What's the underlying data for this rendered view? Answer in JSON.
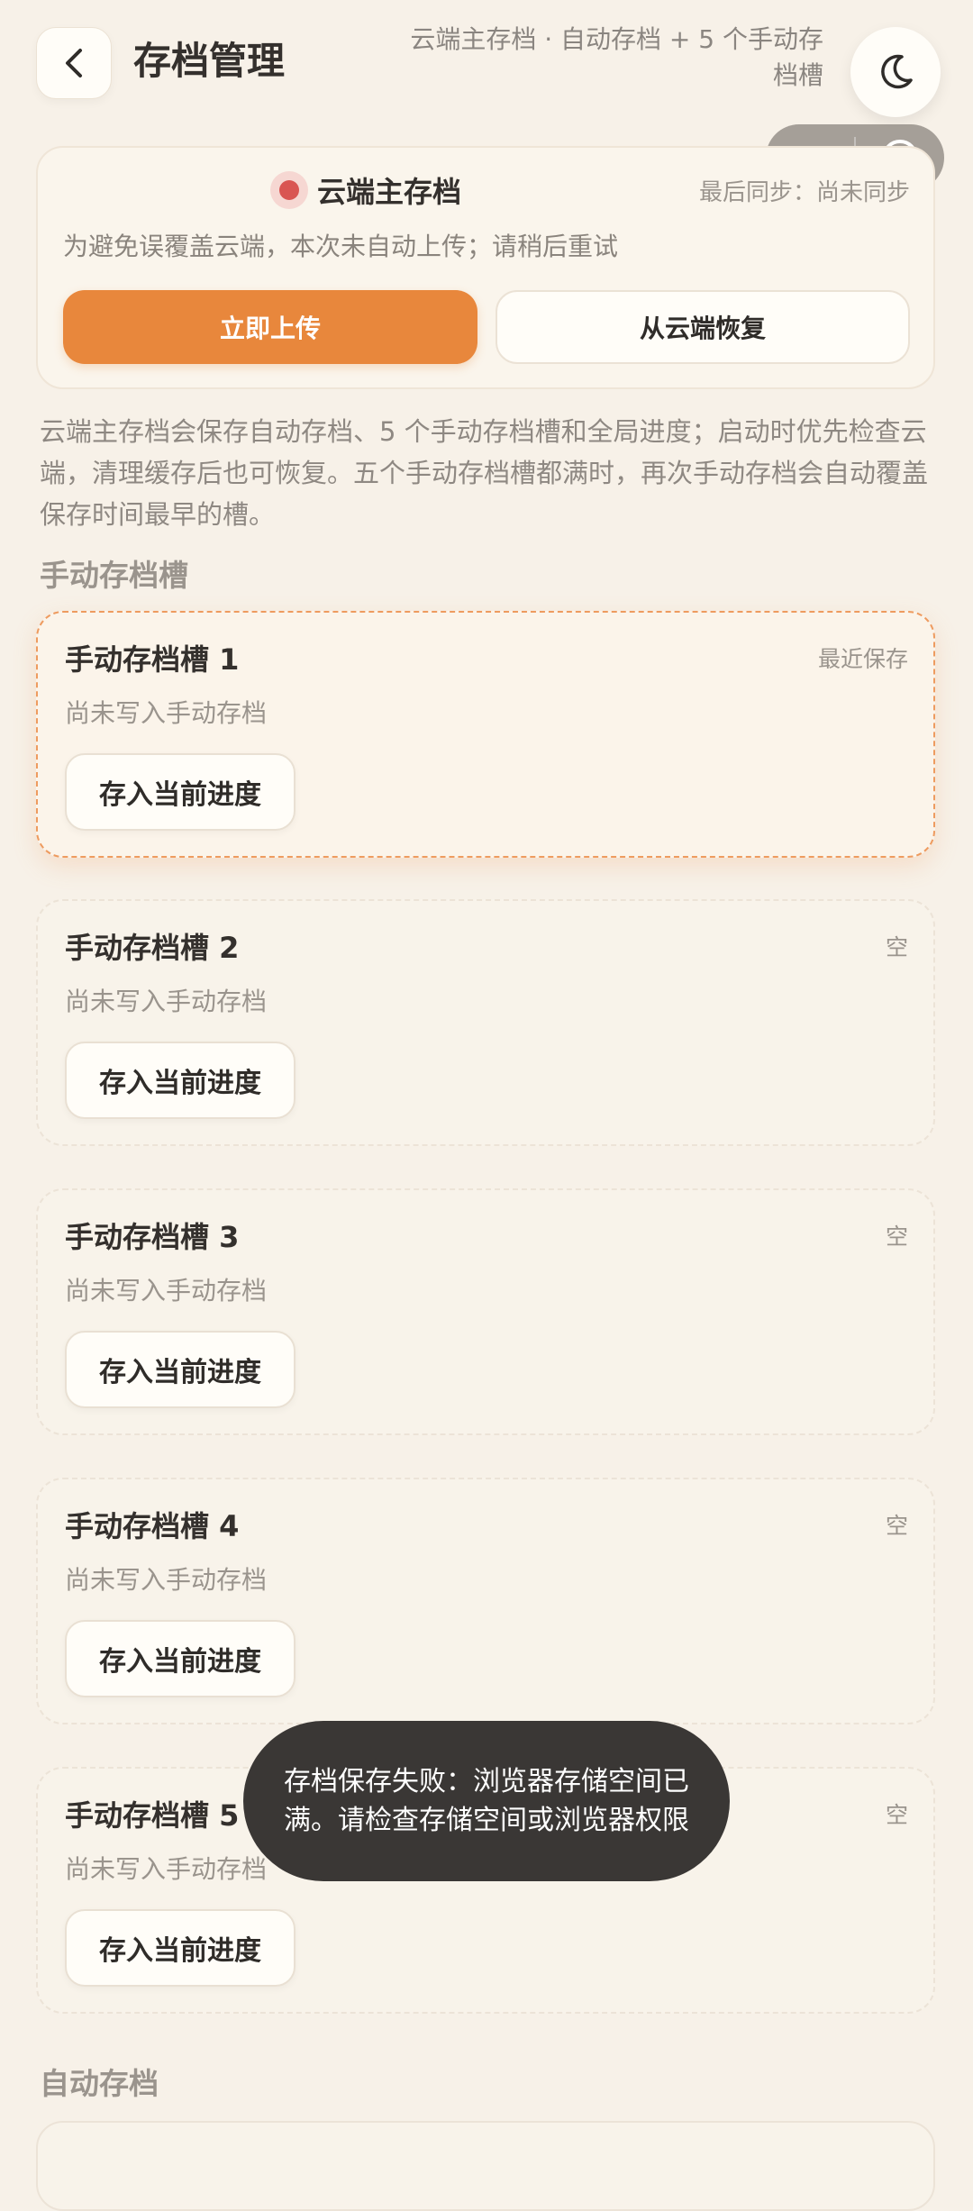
{
  "header": {
    "title": "存档管理",
    "subtitle": "云端主存档 · 自动存档 + 5 个手动存档槽"
  },
  "cloud": {
    "title": "云端主存档",
    "last_sync": "最后同步：尚未同步",
    "message": "为避免误覆盖云端，本次未自动上传；请稍后重试",
    "upload_label": "立即上传",
    "restore_label": "从云端恢复",
    "status_color": "#d95552"
  },
  "explanation": "云端主存档会保存自动存档、5 个手动存档槽和全局进度；启动时优先检查云端，清理缓存后也可恢复。五个手动存档槽都满时，再次手动存档会自动覆盖保存时间最早的槽。",
  "manual_section_label": "手动存档槽",
  "slots": [
    {
      "title": "手动存档槽 1",
      "status": "最近保存",
      "desc": "尚未写入手动存档",
      "button": "存入当前进度"
    },
    {
      "title": "手动存档槽 2",
      "status": "空",
      "desc": "尚未写入手动存档",
      "button": "存入当前进度"
    },
    {
      "title": "手动存档槽 3",
      "status": "空",
      "desc": "尚未写入手动存档",
      "button": "存入当前进度"
    },
    {
      "title": "手动存档槽 4",
      "status": "空",
      "desc": "尚未写入手动存档",
      "button": "存入当前进度"
    },
    {
      "title": "手动存档槽 5",
      "status": "空",
      "desc": "尚未写入手动存档",
      "button": "存入当前进度"
    }
  ],
  "auto_section_label": "自动存档",
  "toast": "存档保存失败：浏览器存储空间已满。请检查存储空间或浏览器权限",
  "colors": {
    "accent": "#e8873c",
    "background": "#f7f1e8"
  }
}
